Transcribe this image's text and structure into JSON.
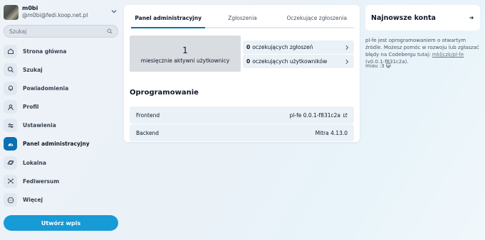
{
  "account": {
    "name": "m0bi",
    "handle": "@m0bi@fedi.koop.net.pl"
  },
  "search": {
    "placeholder": "Szukaj"
  },
  "nav": [
    {
      "label": "Strona główna",
      "icon": "home-icon"
    },
    {
      "label": "Szukaj",
      "icon": "search-icon"
    },
    {
      "label": "Powiadomienia",
      "icon": "bell-icon"
    },
    {
      "label": "Profil",
      "icon": "user-icon"
    },
    {
      "label": "Ustawienia",
      "icon": "sliders-icon"
    },
    {
      "label": "Panel administracyjny",
      "icon": "dashboard-icon",
      "active": true
    },
    {
      "label": "Lokalna",
      "icon": "planet-icon"
    },
    {
      "label": "Fediwersum",
      "icon": "network-icon"
    },
    {
      "label": "Więcej",
      "icon": "more-icon"
    }
  ],
  "compose_label": "Utwórz wpis",
  "tabs": [
    {
      "label": "Panel administracyjny",
      "active": true
    },
    {
      "label": "Zgłoszenia"
    },
    {
      "label": "Oczekujące zgłoszenia"
    }
  ],
  "stats": {
    "active_users_value": "1",
    "active_users_label": "miesięcznie aktywni użytkownicy"
  },
  "pending": [
    {
      "count": "0",
      "label": "oczekujących zgłoszeń"
    },
    {
      "count": "0",
      "label": "oczekujących użytkowników"
    }
  ],
  "software": {
    "title": "Oprogramowanie",
    "frontend_label": "Frontend",
    "frontend_value": "pl-fe 0.0.1-f831c2a",
    "backend_label": "Backend",
    "backend_value": "Mitra 4.13.0"
  },
  "newest": {
    "title": "Najnowsze konta"
  },
  "about": {
    "text": "pl-fe jest oprogramowaniem o otwartym źródle. Możesz pomóc w rozwoju lub zgłaszać błędy na Codebergu tutaj:",
    "link": "mkljczk/pl-fe",
    "version": "(v0.0.1-f831c2a)."
  },
  "meow": "miau :3 😺",
  "colors": {
    "accent": "#0a6fb3",
    "compose": "#169bd6",
    "row_bg": "#eaf2f8"
  }
}
